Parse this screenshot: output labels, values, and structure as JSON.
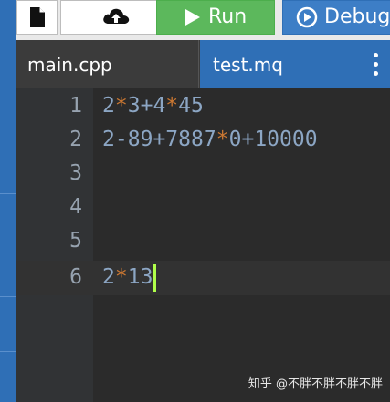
{
  "toolbar": {
    "run_label": "Run",
    "debug_label": "Debug"
  },
  "tabs": [
    {
      "label": "main.cpp"
    },
    {
      "label": "test.mq"
    }
  ],
  "editor": {
    "lines": [
      {
        "number": "1",
        "text": "2*3+4*45"
      },
      {
        "number": "2",
        "text": "2-89+7887*0+10000"
      },
      {
        "number": "3",
        "text": ""
      },
      {
        "number": "4",
        "text": ""
      },
      {
        "number": "5",
        "text": ""
      },
      {
        "number": "6",
        "text": "2*13"
      }
    ],
    "current_line": 6
  },
  "watermark": "知乎 @不胖不胖不胖不胖",
  "colors": {
    "run": "#5cb85c",
    "debug": "#3d7ec6",
    "operator": "#cc7832",
    "cursor": "#b0ff4a"
  }
}
